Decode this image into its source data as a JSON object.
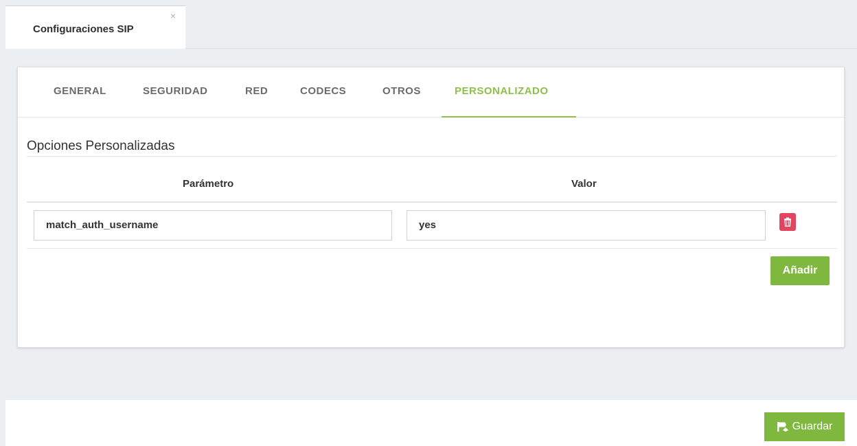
{
  "page_tab": {
    "label": "Configuraciones SIP",
    "close": "×"
  },
  "tabs": [
    {
      "label": "GENERAL"
    },
    {
      "label": "SEGURIDAD"
    },
    {
      "label": "RED"
    },
    {
      "label": "CODECS"
    },
    {
      "label": "OTROS"
    },
    {
      "label": "PERSONALIZADO",
      "active": true
    }
  ],
  "section": {
    "title": "Opciones Personalizadas"
  },
  "table": {
    "headers": [
      "Parámetro",
      "Valor"
    ],
    "rows": [
      {
        "parametro": "match_auth_username",
        "valor": "yes"
      }
    ]
  },
  "buttons": {
    "add": "Añadir",
    "save": "Guardar"
  },
  "icons": {
    "close": "close-icon",
    "delete": "trash-icon",
    "save": "flag-icon"
  },
  "colors": {
    "accent": "#8cc04b",
    "button_green": "#7fb83e",
    "danger": "#e1455f"
  }
}
